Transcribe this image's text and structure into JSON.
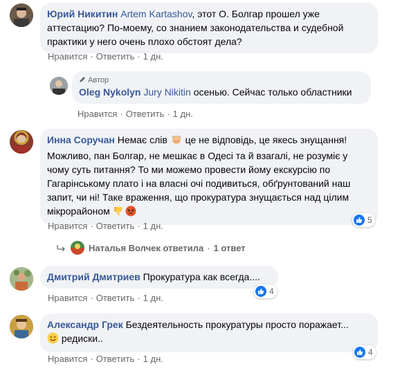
{
  "actions": {
    "like": "Нравится",
    "reply": "Ответить",
    "sep": "·",
    "time": "1 дн."
  },
  "comments": [
    {
      "author": "Юрий Никитин",
      "mention": "Artem Kartashov",
      "text": ", этот О. Болгар прошел уже аттестацию? По-моему, со знанием законодательства и судебной практики у него очень плохо обстоят дела?"
    },
    {
      "tag": "Автор",
      "author": "Oleg Nykolyn",
      "mention": "Jury Nikitin",
      "text": " осенью. Сейчас только областники"
    },
    {
      "author": "Инна Сoручан",
      "text1": "Немає слів ",
      "text2": " це не відповідь, це якесь знущання! Можливо, пан Болгар, не мешкає в Одесі та й взагалі, не розуміє у чому суть питання? То ми можемо провести йому екскурсію по Гагарінському плато і на власні очі подивиться, обґрунтований наш запит, чи ні! Таке враження, що прокуратура знущається над цілим мікрорайоном ",
      "reactions": "5"
    },
    {
      "replies_line": "Наталья Волчек ответила",
      "replies_count": "1 ответ"
    },
    {
      "author": "Дмитрий Дмитриев",
      "text": " Прокуратура как всегда....",
      "reactions": "4"
    },
    {
      "author": "Александр Грек",
      "text1": " Бездеятельность прокуратуры просто поражает...",
      "text2": " редиски..",
      "reactions": "4"
    }
  ]
}
